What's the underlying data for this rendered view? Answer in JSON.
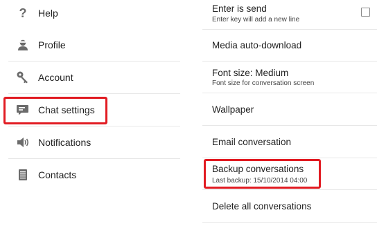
{
  "left_menu": {
    "items": [
      {
        "label": "Help",
        "icon": "help-icon"
      },
      {
        "label": "Profile",
        "icon": "profile-icon"
      },
      {
        "label": "Account",
        "icon": "key-icon"
      },
      {
        "label": "Chat settings",
        "icon": "chat-icon"
      },
      {
        "label": "Notifications",
        "icon": "speaker-icon"
      },
      {
        "label": "Contacts",
        "icon": "contacts-icon"
      }
    ]
  },
  "chat_settings": {
    "enter_is_send": {
      "title": "Enter is send",
      "subtitle": "Enter key will add a new line",
      "checked": false
    },
    "media_auto_download": {
      "title": "Media auto-download"
    },
    "font_size": {
      "title": "Font size: Medium",
      "subtitle": "Font size for conversation screen"
    },
    "wallpaper": {
      "title": "Wallpaper"
    },
    "email_conversation": {
      "title": "Email conversation"
    },
    "backup_conversations": {
      "title": "Backup conversations",
      "subtitle": "Last backup: 15/10/2014 04:00"
    },
    "delete_all": {
      "title": "Delete all conversations"
    }
  },
  "colors": {
    "highlight": "#e11b22",
    "icon": "#6b6b6b",
    "divider": "#e7e7e7"
  }
}
